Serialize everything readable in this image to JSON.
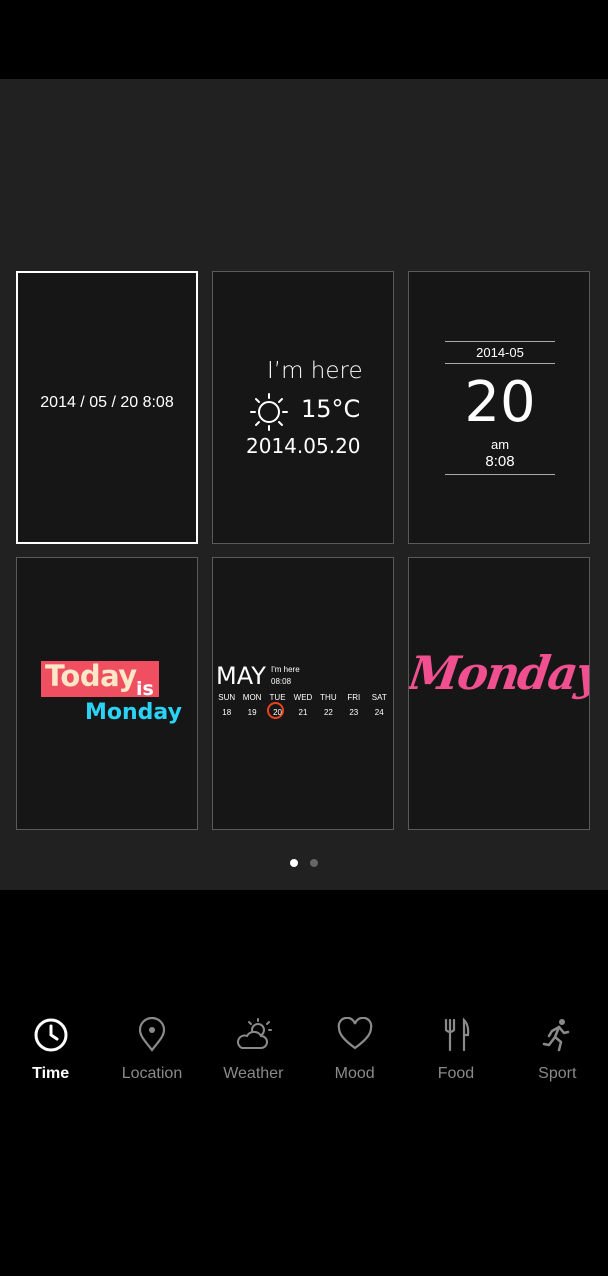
{
  "templates": [
    {
      "text": "2014 / 05 / 20  8:08"
    },
    {
      "line1": "I’m here",
      "temp": "15°C",
      "date": "2014.05.20"
    },
    {
      "year_month": "2014-05",
      "day": "20",
      "ampm": "am",
      "time": "8:08"
    },
    {
      "today": "Today",
      "is": "is",
      "monday": "Monday"
    },
    {
      "month": "MAY",
      "here": "I'm here",
      "time": "08:08",
      "weekdays": [
        "SUN",
        "MON",
        "TUE",
        "WED",
        "THU",
        "FRI",
        "SAT"
      ],
      "dates": [
        "18",
        "19",
        "20",
        "21",
        "22",
        "23",
        "24"
      ]
    },
    {
      "monday": "Monday"
    }
  ],
  "pagination": {
    "count": 2,
    "active": 0
  },
  "tabs": [
    {
      "label": "Time",
      "icon": "clock-icon",
      "active": true
    },
    {
      "label": "Location",
      "icon": "location-pin-icon",
      "active": false
    },
    {
      "label": "Weather",
      "icon": "weather-icon",
      "active": false
    },
    {
      "label": "Mood",
      "icon": "heart-icon",
      "active": false
    },
    {
      "label": "Food",
      "icon": "fork-knife-icon",
      "active": false
    },
    {
      "label": "Sport",
      "icon": "runner-icon",
      "active": false
    }
  ],
  "colors": {
    "accent_red": "#ef4f61",
    "accent_cyan": "#2ad3f6",
    "accent_pink": "#f0508f",
    "circle": "#e8421d"
  }
}
